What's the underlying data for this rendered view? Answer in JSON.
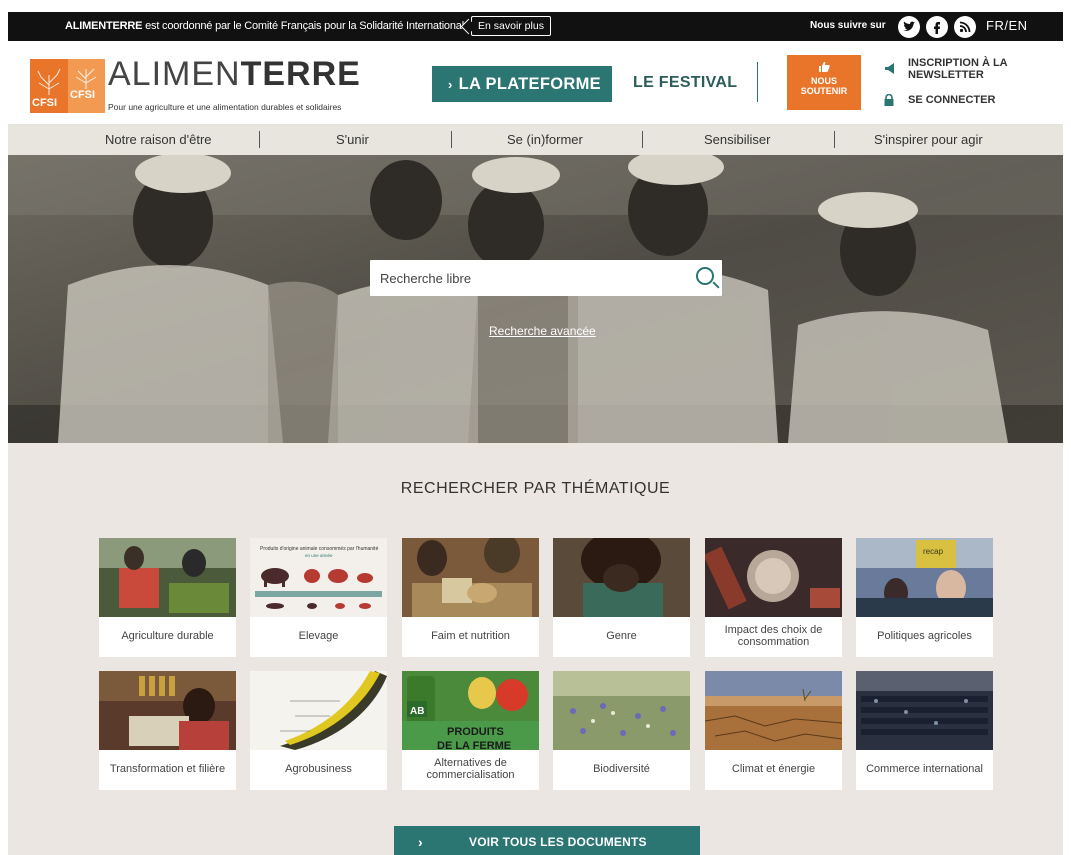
{
  "topbar": {
    "notice_brand": "ALIMENTERRE",
    "notice_rest": " est coordonné par le Comité Français pour la Solidarité Internationale",
    "more_label": "En savoir plus",
    "follow_label": "Nous suivre sur",
    "social": [
      "twitter-icon",
      "facebook-icon",
      "rss-icon"
    ],
    "lang": "FR/EN"
  },
  "header": {
    "logo_text_1": "CFSI",
    "logo_text_2": "CFSI",
    "brand_light": "ALIMEN",
    "brand_bold": "TERRE",
    "tagline": "Pour une agriculture et une alimentation durables et solidaires",
    "plateforme_label": "LA PLATEFORME",
    "festival_label": "LE FESTIVAL",
    "soutenir_label_1": "NOUS",
    "soutenir_label_2": "SOUTENIR",
    "newsletter_label": "INSCRIPTION À LA NEWSLETTER",
    "login_label": "SE CONNECTER"
  },
  "nav": {
    "items": [
      "Notre raison d'être",
      "S'unir",
      "Se (in)former",
      "Sensibiliser",
      "S'inspirer pour agir"
    ]
  },
  "hero": {
    "search_placeholder": "Recherche libre",
    "advanced_label": "Recherche avancée"
  },
  "themes": {
    "title": "RECHERCHER PAR THÉMATIQUE",
    "items": [
      "Agriculture durable",
      "Elevage",
      "Faim et nutrition",
      "Genre",
      "Impact des choix de consommation",
      "Politiques agricoles",
      "Transformation et filière",
      "Agrobusiness",
      "Alternatives de commercialisation",
      "Biodiversité",
      "Climat et énergie",
      "Commerce international"
    ],
    "thumb_texts": {
      "elevage_caption": "Produits d'origine animale consommés par l'humanité",
      "elevage_sub": "en une année",
      "ferme_line1": "PRODUITS",
      "ferme_line2": "DE LA FERME",
      "ab": "AB",
      "recap": "recap"
    },
    "cta_label": "VOIR TOUS LES DOCUMENTS"
  },
  "colors": {
    "teal": "#2b7572",
    "orange": "#e8752a",
    "beige": "#ebe6e2"
  }
}
